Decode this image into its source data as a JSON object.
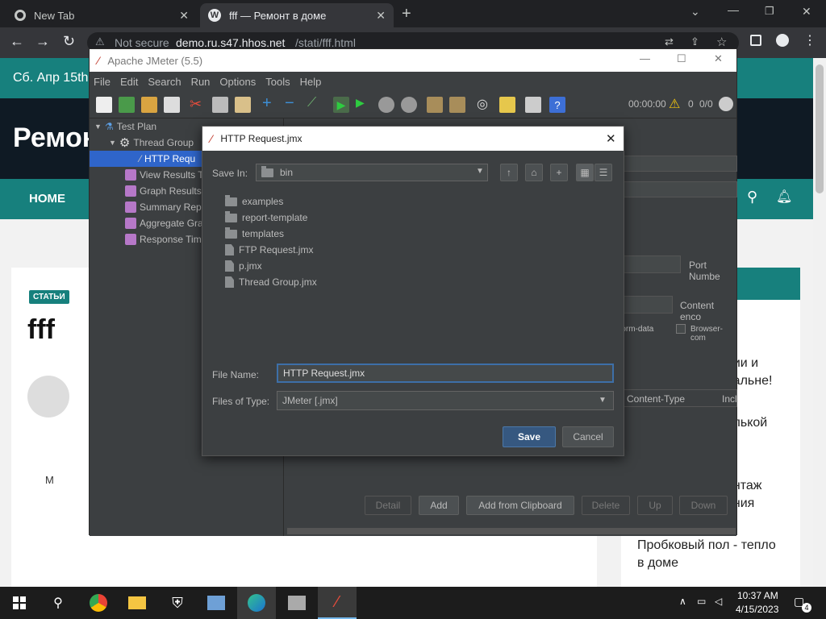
{
  "browser": {
    "tabs": [
      {
        "label": "New Tab"
      },
      {
        "label": "fff — Ремонт в доме"
      }
    ],
    "security": "Not secure",
    "url_host": "demo.ru.s47.hhos.net",
    "url_path": "/stati/fff.html"
  },
  "website": {
    "date": "Сб. Апр 15th,",
    "logo_partial": "Ремон",
    "nav_home": "HOME",
    "category_badge": "СТАТЬИ",
    "post_title": "fff",
    "author_initial": "M",
    "sidebar_items": [
      {
        "line1": "нии и",
        "line2": "пальне!"
      },
      {
        "line1": "олькой",
        "line2": ""
      },
      {
        "line1": "онтаж",
        "line2": "ения"
      },
      {
        "line1": "Пробковый пол - тепло",
        "line2": "в доме"
      }
    ]
  },
  "jmeter": {
    "title": "Apache JMeter (5.5)",
    "menu": [
      "File",
      "Edit",
      "Search",
      "Run",
      "Options",
      "Tools",
      "Help"
    ],
    "timer": "00:00:00",
    "warnings": "0",
    "threads": "0/0",
    "tree": [
      {
        "label": "Test Plan"
      },
      {
        "label": "Thread Group"
      },
      {
        "label": "HTTP Requ"
      },
      {
        "label": "View Results Tr"
      },
      {
        "label": "Graph Results"
      },
      {
        "label": "Summary Repo"
      },
      {
        "label": "Aggregate Gra"
      },
      {
        "label": "Response Time"
      }
    ],
    "right_labels": {
      "port": "Port Numbe",
      "content_encoding": "Content enco",
      "form_data": "t/form-data",
      "browser_compat": "Browser-com",
      "content_type": "Content-Type",
      "incl": "Incl"
    },
    "bottom_buttons": [
      "Detail",
      "Add",
      "Add from Clipboard",
      "Delete",
      "Up",
      "Down"
    ]
  },
  "dialog": {
    "title": "HTTP Request.jmx",
    "save_in_label": "Save In:",
    "save_in_value": "bin",
    "items": [
      {
        "name": "examples",
        "kind": "folder"
      },
      {
        "name": "report-template",
        "kind": "folder"
      },
      {
        "name": "templates",
        "kind": "folder"
      },
      {
        "name": "FTP Request.jmx",
        "kind": "file"
      },
      {
        "name": "p.jmx",
        "kind": "file"
      },
      {
        "name": "Thread Group.jmx",
        "kind": "file"
      }
    ],
    "file_name_label": "File Name:",
    "file_name_value": "HTTP Request.jmx",
    "files_of_type_label": "Files of Type:",
    "files_of_type_value": "JMeter [.jmx]",
    "save_button": "Save",
    "cancel_button": "Cancel"
  },
  "taskbar": {
    "time": "10:37 AM",
    "date": "4/15/2023",
    "notifications": "4"
  },
  "colors": {
    "site_accent": "#17807d",
    "jmeter_bg": "#3c3f41",
    "save_button": "#365880"
  }
}
